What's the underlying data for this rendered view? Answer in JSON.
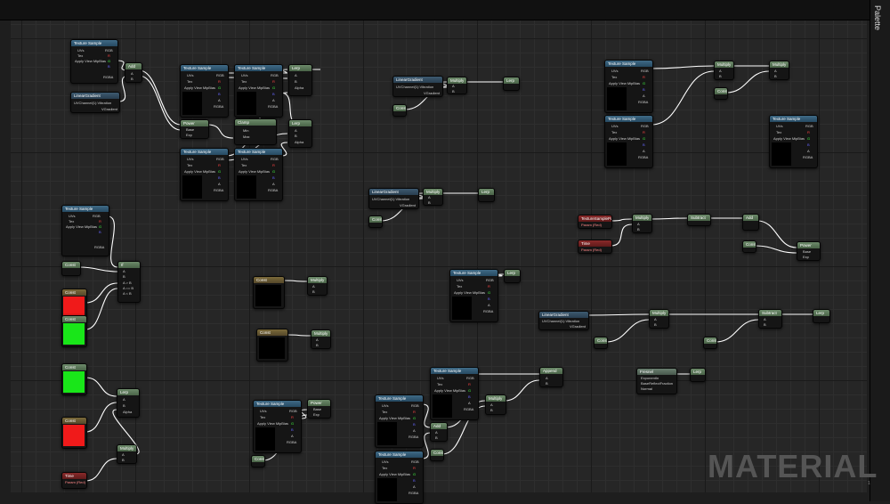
{
  "palette_label": "Palette",
  "watermark": "MATERIAL",
  "page_number": "1",
  "colors": {
    "wire": "#ffffff",
    "red_swatch": "#f01a1a",
    "green_swatch": "#19e619",
    "graph_bg": "#262626"
  },
  "labels": {
    "texture_sample": "Texture Sample",
    "uvs": "UVs",
    "tex": "Tex",
    "apply_view_mip_bias": "Apply View MipBias",
    "rgb": "RGB",
    "r": "R",
    "g": "G",
    "b": "B",
    "a": "A",
    "rgba": "RGBA",
    "linear_gradient": "LinearGradient",
    "uv_channel": "UVChannel(1):Vibration",
    "vgradient": "VGradient",
    "add": "Add",
    "multiply": "Multiply",
    "lerp": "Lerp",
    "alpha": "Alpha",
    "power": "Power",
    "base": "Base",
    "exp": "Exp",
    "clamp": "Clamp",
    "min": "Min",
    "max": "Max",
    "subtract": "Subtract",
    "divide": "Divide",
    "if": "If",
    "a_gt_b": "A > B",
    "a_eq_b": "A == B",
    "a_lt_b": "A < B",
    "const": "Const",
    "appendvector": "Append",
    "texcoord": "TexCoord[0]",
    "fresnel": "Fresnel",
    "exponent": "ExponentIn",
    "base_reflect": "BaseReflectFraction",
    "normal": "Normal",
    "param_red": "TextureSampleParam",
    "param_sub": "Param (Red)",
    "time": "Time",
    "time_sub": "Param (Red)"
  }
}
